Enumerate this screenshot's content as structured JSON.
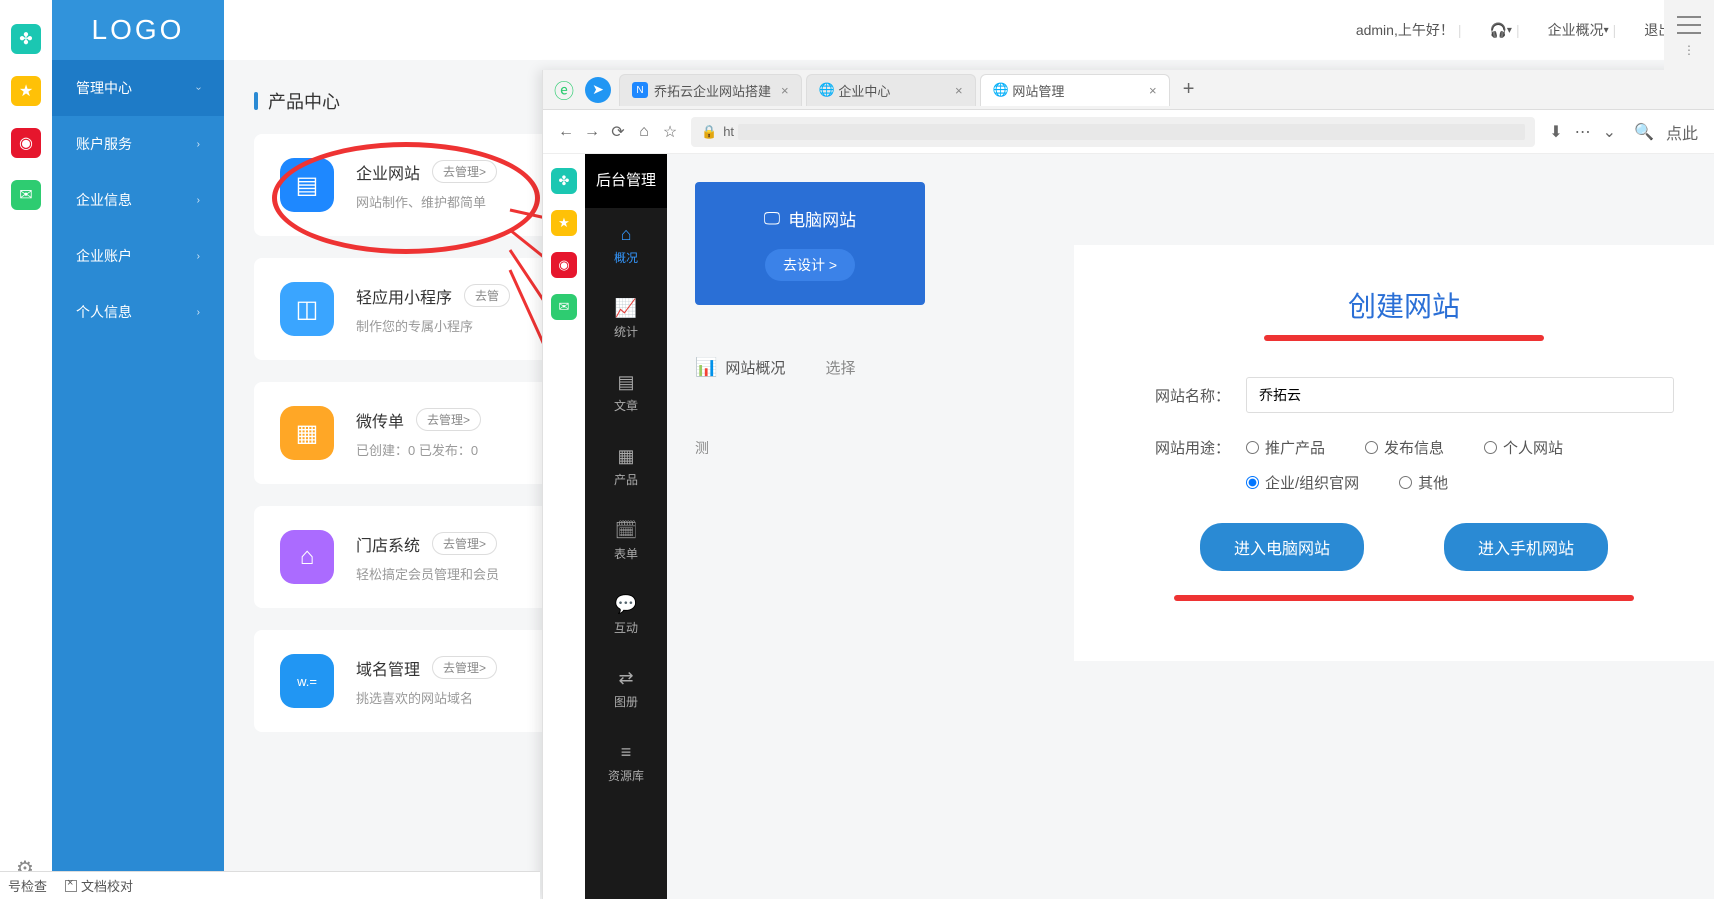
{
  "mini_icons": [
    "clover",
    "star",
    "weibo",
    "mail"
  ],
  "logo": "LOGO",
  "sidebar": {
    "items": [
      {
        "label": "管理中心",
        "expand": true
      },
      {
        "label": "账户服务"
      },
      {
        "label": "企业信息"
      },
      {
        "label": "企业账户"
      },
      {
        "label": "个人信息"
      }
    ]
  },
  "topbar": {
    "greeting": "admin,上午好！",
    "overview": "企业概况",
    "logout": "退出"
  },
  "section_title": "产品中心",
  "cards": [
    {
      "title": "企业网站",
      "btn": "去管理>",
      "desc": "网站制作、维护都简单"
    },
    {
      "title": "轻应用小程序",
      "btn": "去管",
      "desc": "制作您的专属小程序"
    },
    {
      "title": "微传单",
      "btn": "去管理>",
      "desc": "已创建：0   已发布：0"
    },
    {
      "title": "门店系统",
      "btn": "去管理>",
      "desc": "轻松搞定会员管理和会员"
    },
    {
      "title": "域名管理",
      "btn": "去管理>",
      "desc": "挑选喜欢的网站域名"
    }
  ],
  "tabs": [
    {
      "label": "乔拓云企业网站搭建",
      "active": false,
      "icon": "N"
    },
    {
      "label": "企业中心",
      "active": false,
      "icon": "globe"
    },
    {
      "label": "网站管理",
      "active": true,
      "icon": "globe"
    }
  ],
  "url_prefix": "ht",
  "url_right_hint": "点此",
  "backend_title": "后台管理",
  "black_nav": [
    {
      "label": "概况",
      "icon": "home",
      "active": true
    },
    {
      "label": "统计",
      "icon": "chart"
    },
    {
      "label": "文章",
      "icon": "doc"
    },
    {
      "label": "产品",
      "icon": "grid"
    },
    {
      "label": "表单",
      "icon": "cal"
    },
    {
      "label": "互动",
      "icon": "chat"
    },
    {
      "label": "图册",
      "icon": "swap"
    },
    {
      "label": "资源库",
      "icon": "db"
    }
  ],
  "pc_card": {
    "label": "电脑网站",
    "go": "去设计 >"
  },
  "overview_row": {
    "title": "网站概况",
    "select": "选择"
  },
  "test_char": "测",
  "create": {
    "title": "创建网站",
    "name_label": "网站名称：",
    "name_value": "乔拓云",
    "use_label": "网站用途：",
    "options": [
      "推广产品",
      "发布信息",
      "个人网站",
      "企业/组织官网",
      "其他"
    ],
    "selected": "企业/组织官网",
    "btn_pc": "进入电脑网站",
    "btn_mobile": "进入手机网站"
  },
  "status": {
    "check": "号检查",
    "proof": "文档校对"
  }
}
